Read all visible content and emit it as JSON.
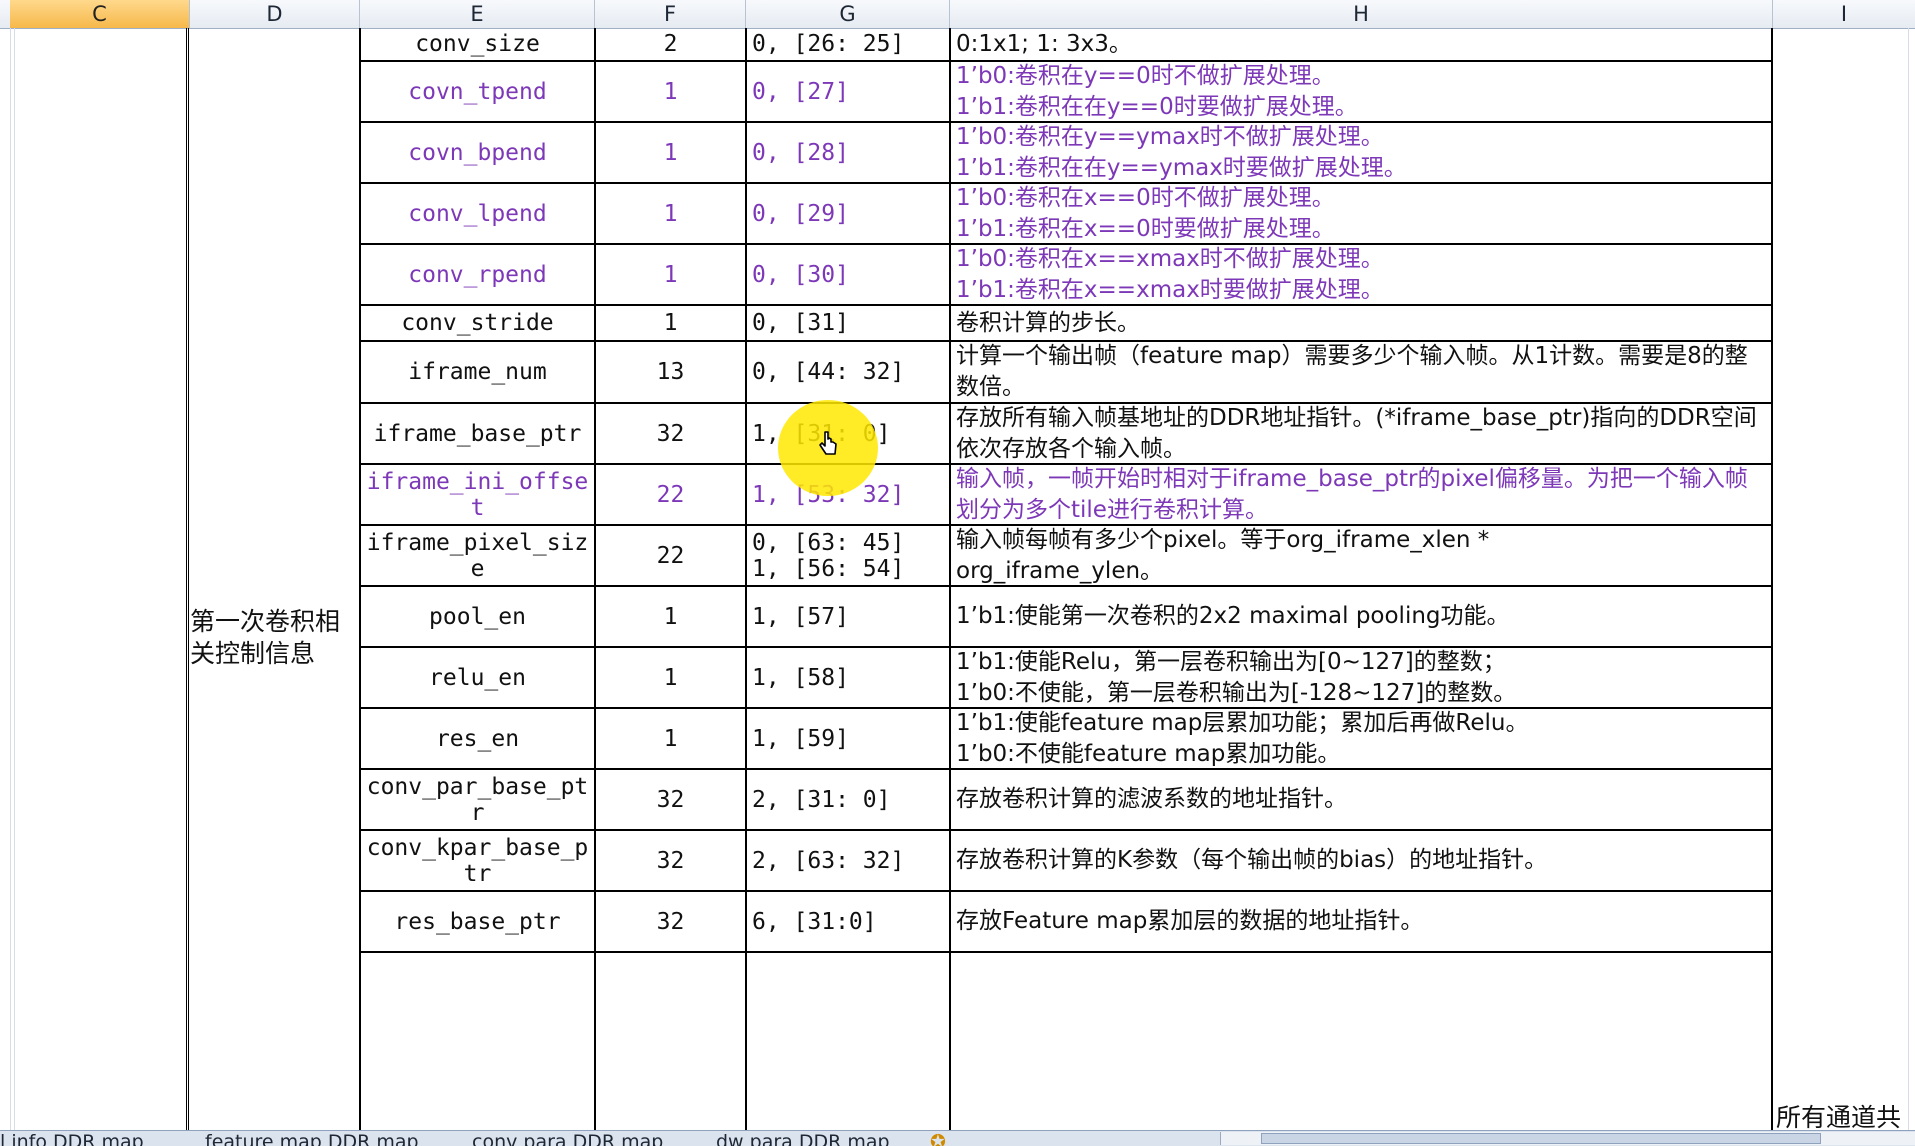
{
  "columns": [
    "C",
    "D",
    "E",
    "F",
    "G",
    "H",
    "I"
  ],
  "selected_column": "C",
  "section_label": "第一次卷积相关控制信息",
  "side_note": "所有通道共",
  "rows": [
    {
      "name": "conv_size",
      "bits": "2",
      "pos": "0, [26: 25]",
      "desc": "0:1x1; 1: 3x3。",
      "purple": false
    },
    {
      "name": "covn_tpend",
      "bits": "1",
      "pos": "0, [27]",
      "desc": "1’b0:卷积在y==0时不做扩展处理。\n1’b1:卷积在在y==0时要做扩展处理。",
      "purple": true
    },
    {
      "name": "covn_bpend",
      "bits": "1",
      "pos": "0, [28]",
      "desc": "1’b0:卷积在y==ymax时不做扩展处理。\n1’b1:卷积在在y==ymax时要做扩展处理。",
      "purple": true
    },
    {
      "name": "conv_lpend",
      "bits": "1",
      "pos": "0, [29]",
      "desc": "1’b0:卷积在x==0时不做扩展处理。\n1’b1:卷积在x==0时要做扩展处理。",
      "purple": true
    },
    {
      "name": "conv_rpend",
      "bits": "1",
      "pos": "0, [30]",
      "desc": "1’b0:卷积在x==xmax时不做扩展处理。\n1’b1:卷积在x==xmax时要做扩展处理。",
      "purple": true
    },
    {
      "name": "conv_stride",
      "bits": "1",
      "pos": "0, [31]",
      "desc": "卷积计算的步长。",
      "purple": false
    },
    {
      "name": "iframe_num",
      "bits": "13",
      "pos": "0, [44: 32]",
      "desc": "计算一个输出帧（feature map）需要多少个输入帧。从1计数。需要是8的整数倍。",
      "purple": false
    },
    {
      "name": "iframe_base_ptr",
      "bits": "32",
      "pos": "1, [31: 0]",
      "desc": "存放所有输入帧基地址的DDR地址指针。(*iframe_base_ptr)指向的DDR空间依次存放各个输入帧。",
      "purple": false
    },
    {
      "name": "iframe_ini_offset",
      "bits": "22",
      "pos": "1, [53: 32]",
      "desc": "输入帧，一帧开始时相对于iframe_base_ptr的pixel偏移量。为把一个输入帧划分为多个tile进行卷积计算。",
      "purple": true
    },
    {
      "name": "iframe_pixel_size",
      "bits": "22",
      "pos": "0, [63: 45]\n1, [56: 54]",
      "desc": "输入帧每帧有多少个pixel。等于org_iframe_xlen *\norg_iframe_ylen。",
      "purple": false
    },
    {
      "name": "pool_en",
      "bits": "1",
      "pos": "1, [57]",
      "desc": "1’b1:使能第一次卷积的2x2 maximal pooling功能。",
      "purple": false
    },
    {
      "name": "relu_en",
      "bits": "1",
      "pos": "1, [58]",
      "desc": "1’b1:使能Relu，第一层卷积输出为[0~127]的整数；\n1’b0:不使能，第一层卷积输出为[-128~127]的整数。",
      "purple": false
    },
    {
      "name": "res_en",
      "bits": "1",
      "pos": "1, [59]",
      "desc": "1’b1:使能feature map层累加功能；累加后再做Relu。\n1’b0:不使能feature map累加功能。",
      "purple": false
    },
    {
      "name": "conv_par_base_ptr",
      "bits": "32",
      "pos": "2, [31: 0]",
      "desc": "存放卷积计算的滤波系数的地址指针。",
      "purple": false
    },
    {
      "name": "conv_kpar_base_ptr",
      "bits": "32",
      "pos": "2, [63: 32]",
      "desc": "存放卷积计算的K参数（每个输出帧的bias）的地址指针。",
      "purple": false
    },
    {
      "name": "res_base_ptr",
      "bits": "32",
      "pos": "6, [31:0]",
      "desc": "存放Feature map累加层的数据的地址指针。",
      "purple": false
    }
  ],
  "sheet_tabs": [
    "l info DDR map",
    "feature map DDR map",
    "conv para DDR map",
    "dw para DDR map"
  ]
}
